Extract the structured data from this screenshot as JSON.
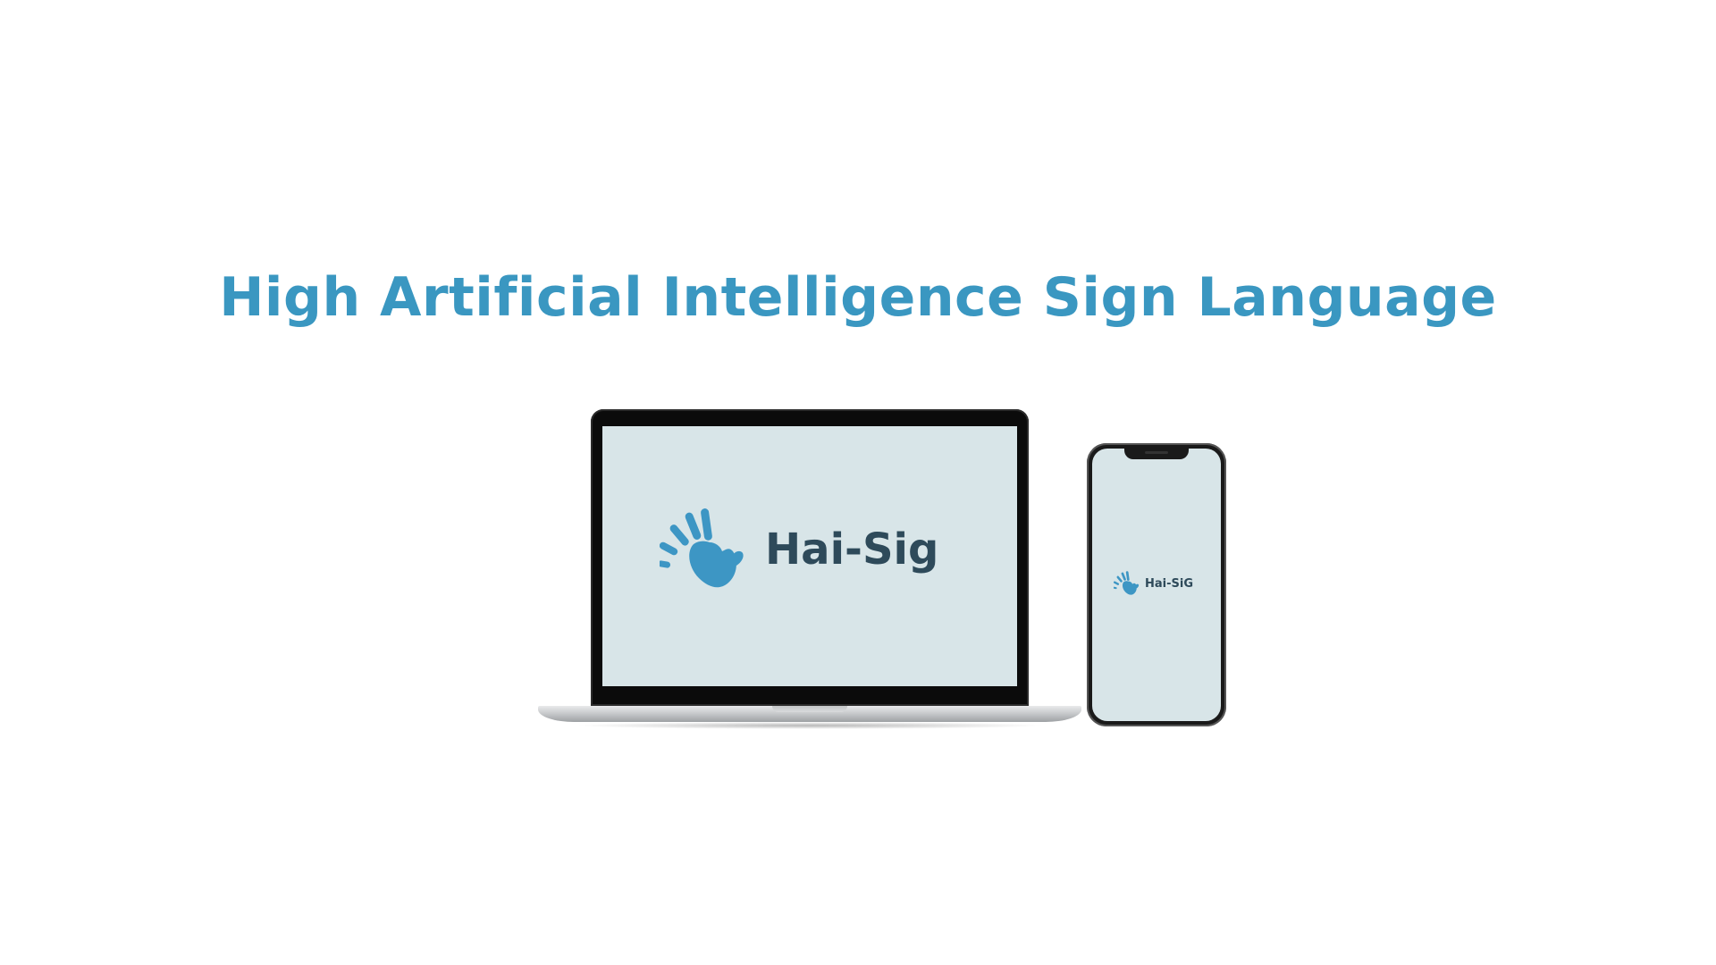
{
  "headline": {
    "text": "High Artificial Intelligence Sign Language"
  },
  "laptop": {
    "brand_text": "Hai-Sig",
    "logo_icon": "hand-print-icon"
  },
  "phone": {
    "brand_text": "Hai-SiG",
    "logo_icon": "hand-print-icon"
  },
  "colors": {
    "headline": "#3a97c1",
    "screen_bg": "#d8e5e8",
    "hand": "#3d96c4",
    "brand_text": "#2e4a5a"
  }
}
